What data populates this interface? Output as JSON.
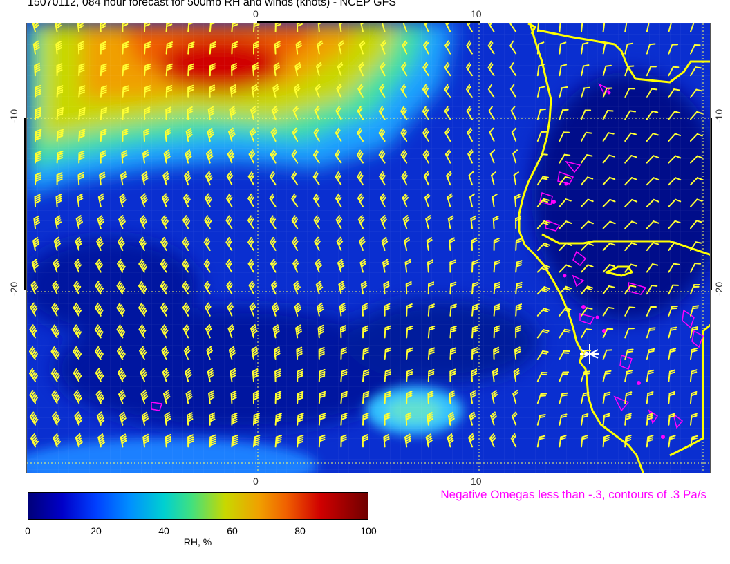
{
  "title": "15070112, 084 hour forecast for 500mb RH and winds (knots) - NCEP GFS",
  "axes": {
    "lon_top": [
      "0",
      "10"
    ],
    "lon_bottom": [
      "0",
      "10"
    ],
    "lat_left": [
      "-10",
      "-20"
    ],
    "lat_right": [
      "-10",
      "-20"
    ]
  },
  "colorbar": {
    "ticks": [
      "0",
      "20",
      "40",
      "60",
      "80",
      "100"
    ],
    "label": "RH, %"
  },
  "omega_note": "Negative Omegas less than -.3, contours of .3 Pa/s",
  "colors": {
    "barb": "#ffff33",
    "coast": "#ffff00",
    "omega": "#ff00ff",
    "grid": "#ffff66",
    "ocean_base": "#0a2fd0"
  }
}
